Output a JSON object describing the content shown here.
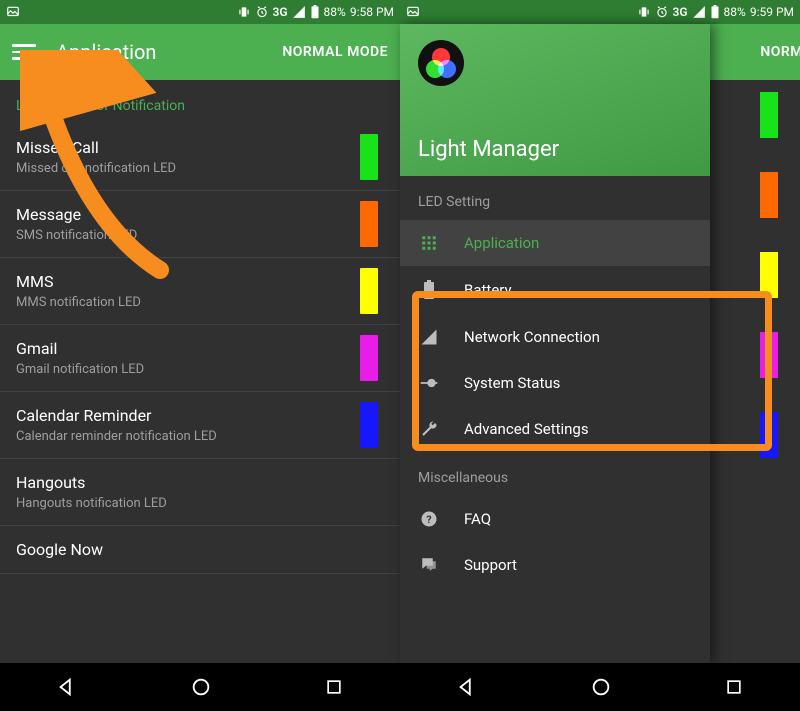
{
  "left": {
    "status": {
      "network": "3G",
      "battery": "88%",
      "time": "9:58 PM"
    },
    "header": {
      "title": "Application",
      "mode": "NORMAL MODE"
    },
    "section_label": "LED Setting for Notification",
    "items": [
      {
        "title": "Missed Call",
        "sub": "Missed call notification LED",
        "color": "#18e218"
      },
      {
        "title": "Message",
        "sub": "SMS notification LED",
        "color": "#ff6a00"
      },
      {
        "title": "MMS",
        "sub": "MMS notification LED",
        "color": "#ffff00"
      },
      {
        "title": "Gmail",
        "sub": "Gmail notification LED",
        "color": "#e81ee8"
      },
      {
        "title": "Calendar Reminder",
        "sub": "Calendar reminder notification LED",
        "color": "#1616ff"
      },
      {
        "title": "Hangouts",
        "sub": "Hangouts notification LED",
        "color": ""
      },
      {
        "title": "Google Now",
        "sub": "",
        "color": ""
      }
    ]
  },
  "right": {
    "status": {
      "network": "3G",
      "battery": "88%",
      "time": "9:59 PM"
    },
    "header_mode": "NORMAL MODE",
    "bg_swatch_colors": [
      "#18e218",
      "#ff6a00",
      "#ffff00",
      "#e81ee8",
      "#1616ff"
    ],
    "drawer": {
      "title": "Light Manager",
      "sections": [
        {
          "label": "LED Setting",
          "items": [
            {
              "icon": "grid",
              "label": "Application",
              "active": true
            },
            {
              "icon": "battery",
              "label": "Battery",
              "active": false
            },
            {
              "icon": "signal",
              "label": "Network Connection",
              "active": false
            },
            {
              "icon": "slider",
              "label": "System Status",
              "active": false
            },
            {
              "icon": "wrench",
              "label": "Advanced Settings",
              "active": false
            }
          ]
        },
        {
          "label": "Miscellaneous",
          "items": [
            {
              "icon": "help",
              "label": "FAQ",
              "active": false
            },
            {
              "icon": "chat",
              "label": "Support",
              "active": false
            }
          ]
        }
      ]
    }
  }
}
